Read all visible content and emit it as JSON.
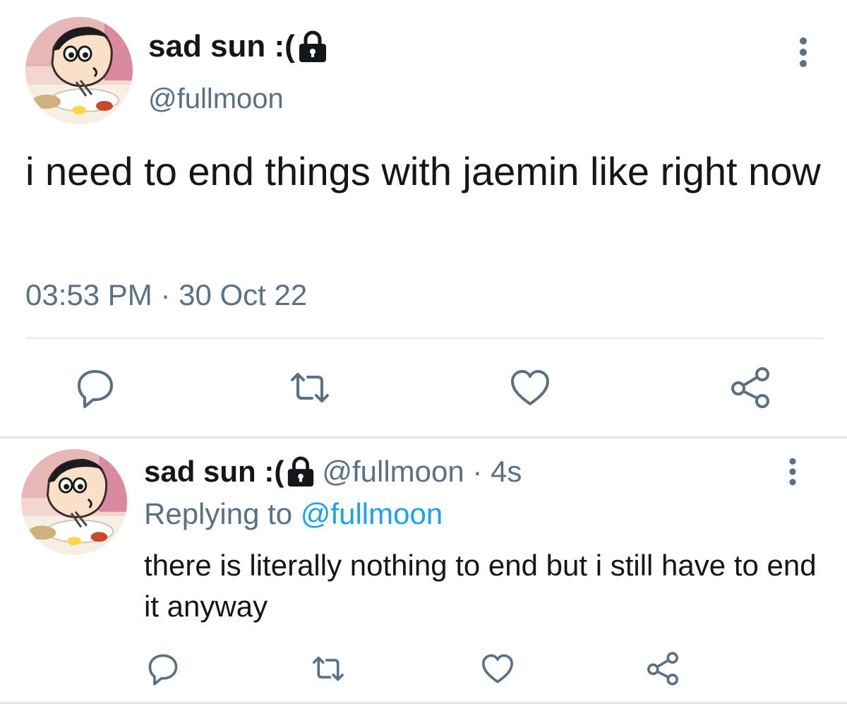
{
  "colors": {
    "text": "#14171a",
    "muted": "#5b7083",
    "link": "#1da1f2",
    "divider": "#e1e8ed"
  },
  "main_tweet": {
    "display_name": "sad sun :(",
    "handle": "@fullmoon",
    "text": "i need to end things with jaemin like right now",
    "timestamp": "03:53 PM · 30 Oct 22",
    "icons": {
      "verified_lock": "lock-icon",
      "more": "more-options-icon",
      "reply": "reply-icon",
      "retweet": "retweet-icon",
      "like": "heart-icon",
      "share": "share-icon"
    }
  },
  "reply_tweet": {
    "display_name": "sad sun :(",
    "handle": "@fullmoon",
    "separator": " · ",
    "age": "4s",
    "replying_label": "Replying to ",
    "replying_to": "@fullmoon",
    "text": "there is literally nothing to end but i still have to end it anyway"
  }
}
